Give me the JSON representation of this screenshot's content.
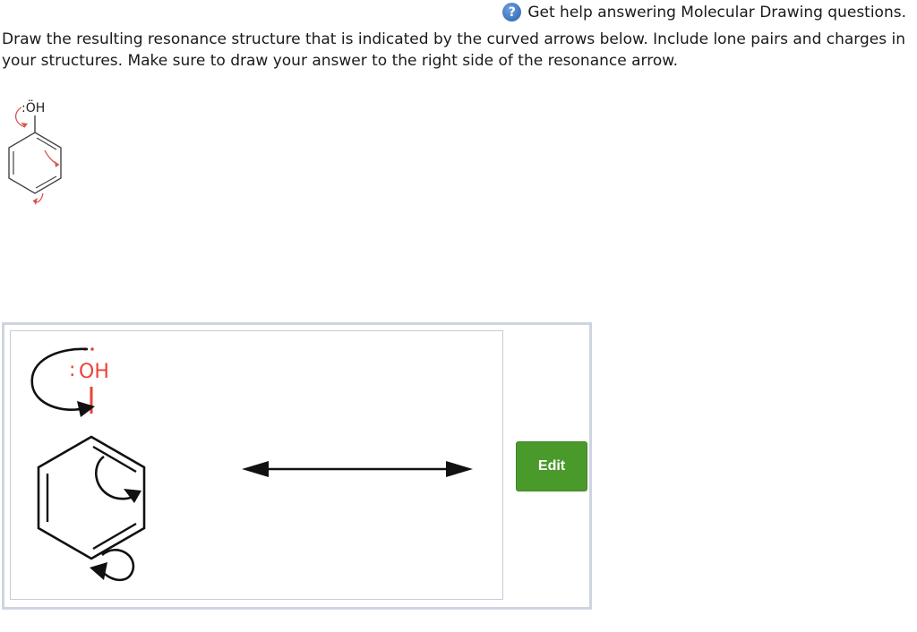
{
  "help": {
    "icon": "help-question-icon",
    "link_text": "Get help answering Molecular Drawing questions."
  },
  "question": {
    "text": "Draw the resulting resonance structure that is indicated by the curved arrows below. Include lone pairs and charges in your structures. Make sure to draw your answer to the right side of the resonance arrow."
  },
  "prompt_molecule": {
    "label": ":ÖH",
    "arrow_color": "#d9534f"
  },
  "answer_canvas": {
    "oh_label": "OH",
    "lone_pair_marks": ":",
    "oh_color": "#e8443a",
    "resonance_arrow": "double-headed-arrow"
  },
  "edit_button": {
    "label": "Edit",
    "color": "#4a9a2b"
  }
}
